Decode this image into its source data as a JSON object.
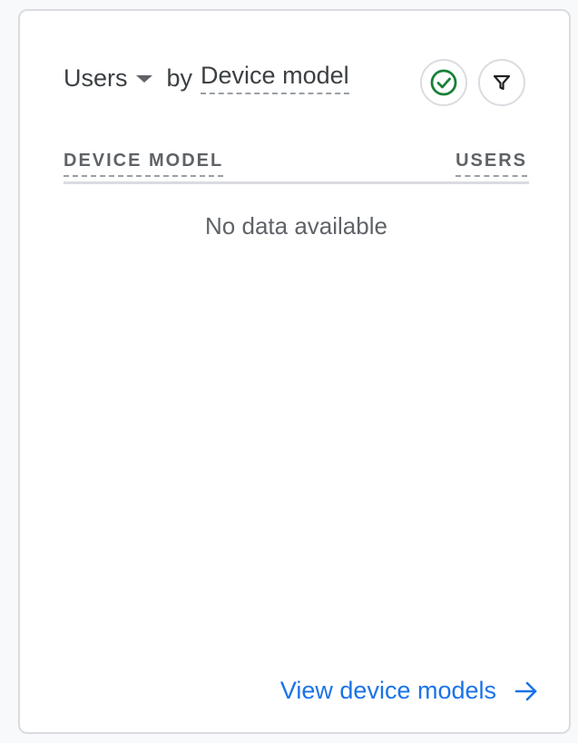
{
  "card": {
    "metric_label": "Users",
    "by_label": "by",
    "dimension_label": "Device model",
    "icons": {
      "status": "check-circle-icon",
      "filter": "filter-icon",
      "metric_dropdown": "caret-down-icon",
      "link_arrow": "arrow-right-icon"
    }
  },
  "table": {
    "columns": [
      "DEVICE MODEL",
      "USERS"
    ],
    "empty_message": "No data available"
  },
  "footer": {
    "link_label": "View device models"
  },
  "colors": {
    "status_green": "#188038",
    "link_blue": "#1a73e8",
    "text_primary": "#3c4043",
    "text_secondary": "#5f6368",
    "border": "#dadce0"
  }
}
